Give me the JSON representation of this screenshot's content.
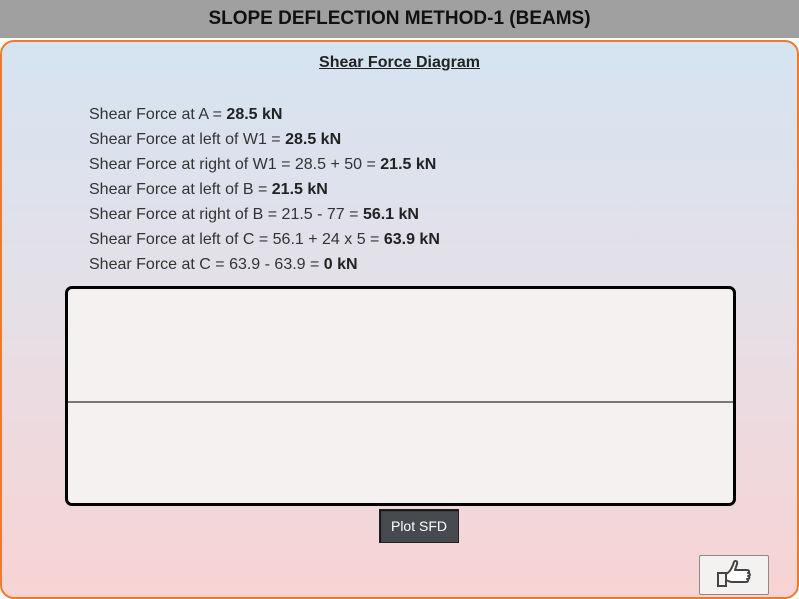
{
  "title": "SLOPE DEFLECTION METHOD-1 (BEAMS)",
  "section_title": "Shear Force Diagram",
  "lines": [
    {
      "text": "Shear Force at A = ",
      "value": "28.5 kN"
    },
    {
      "text": "Shear Force at left of W1 = ",
      "value": "28.5 kN"
    },
    {
      "text": "Shear Force at right of W1 = 28.5 + 50 = ",
      "value": "21.5 kN"
    },
    {
      "text": "Shear Force at left of B = ",
      "value": "21.5 kN"
    },
    {
      "text": "Shear Force at right of B = 21.5 - 77 = ",
      "value": "56.1 kN"
    },
    {
      "text": "Shear Force at left of C = 56.1 + 24 x 5 = ",
      "value": "63.9 kN"
    },
    {
      "text": "Shear Force at C = 63.9 - 63.9 = ",
      "value": "0 kN"
    }
  ],
  "plot_button_label": "Plot SFD",
  "next_button_icon": "thumbs-up-icon",
  "colors": {
    "accent_border": "#f07a2a",
    "title_bar": "#a0a0a0",
    "button_dark": "#474b50"
  }
}
